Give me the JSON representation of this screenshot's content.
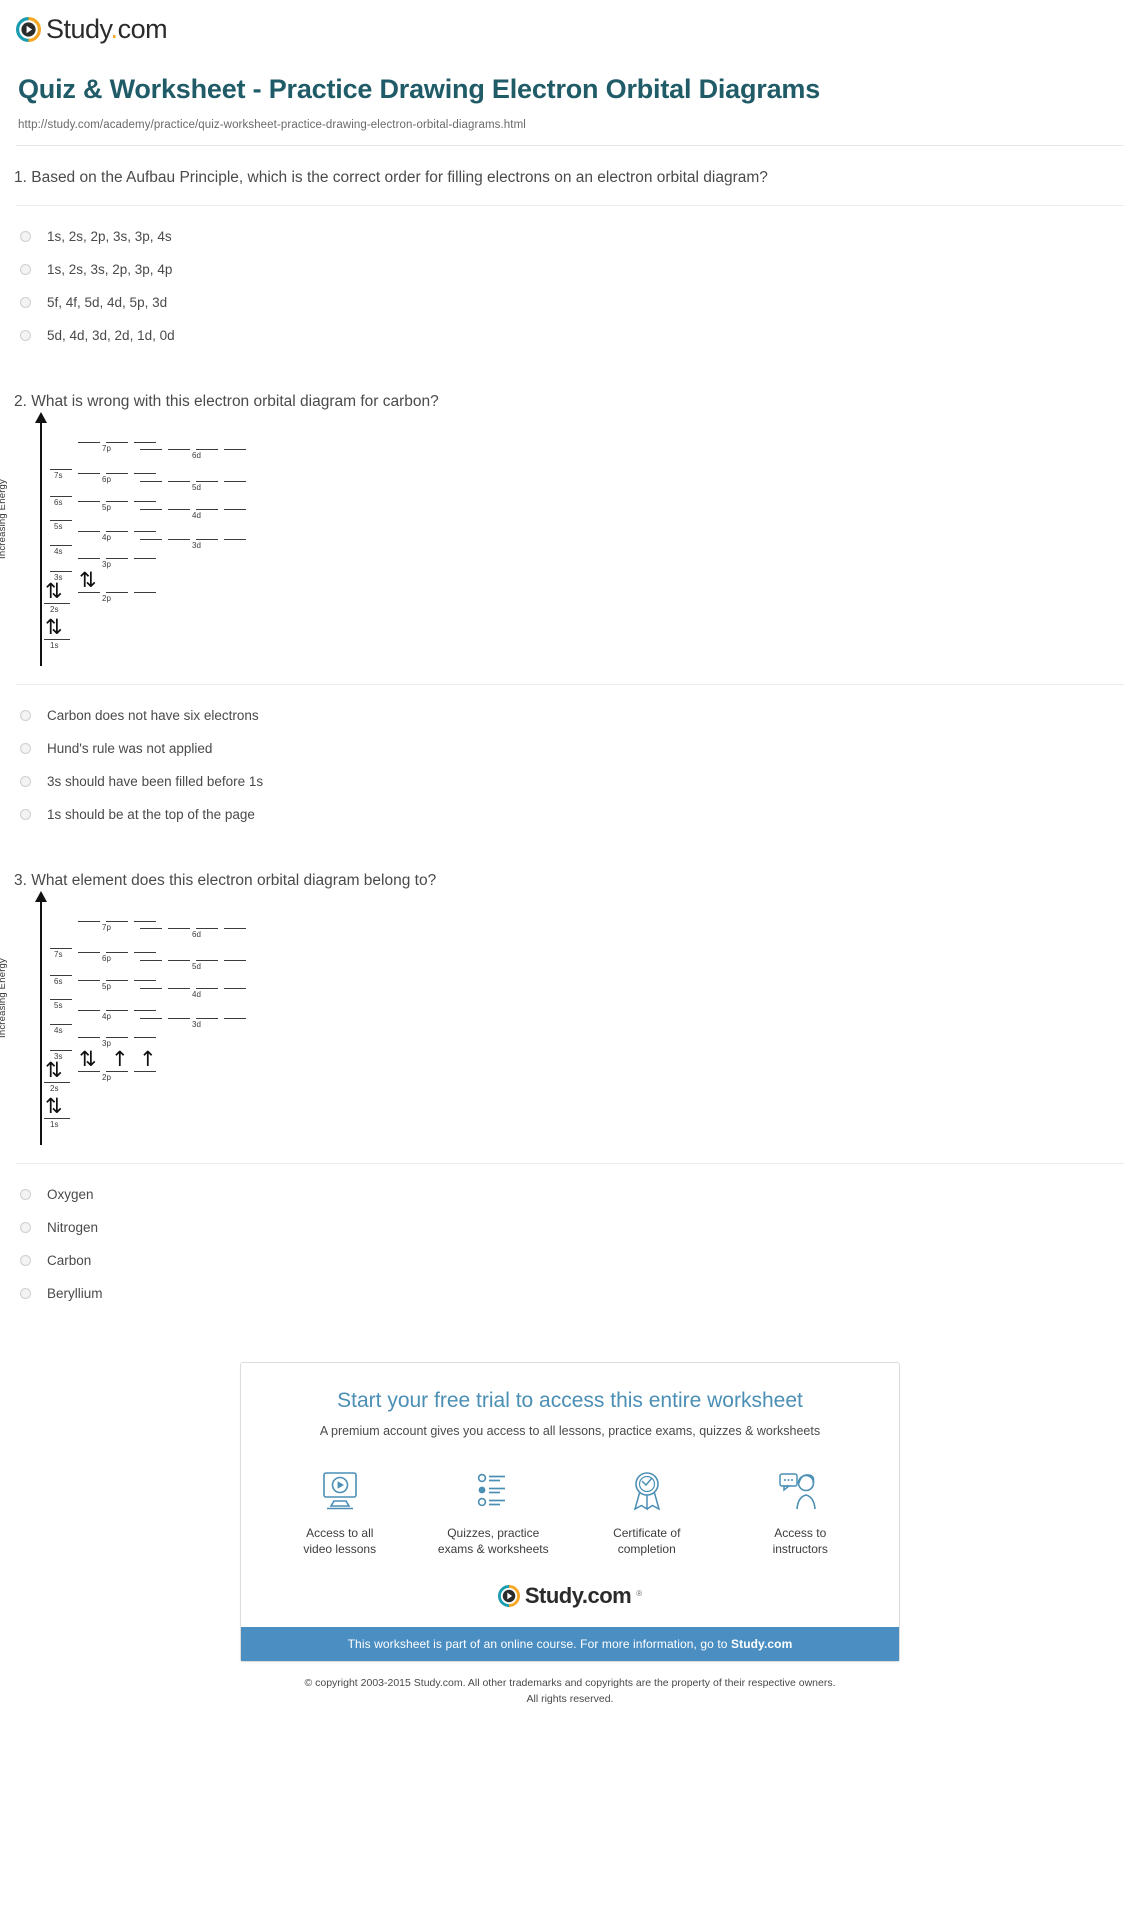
{
  "brand": {
    "logo_text": "Study",
    "logo_dot": ".",
    "logo_suffix": "com",
    "logo_icon": "play-circle-icon",
    "accent_teal": "#1a9cb0",
    "accent_orange": "#f5a623",
    "title_color": "#205b68",
    "banner_color": "#4a8ec2"
  },
  "header": {
    "title": "Quiz & Worksheet - Practice Drawing Electron Orbital Diagrams",
    "url": "http://study.com/academy/practice/quiz-worksheet-practice-drawing-electron-orbital-diagrams.html"
  },
  "questions": [
    {
      "number": "1.",
      "text": "1. Based on the Aufbau Principle, which is the correct order for filling electrons on an electron orbital diagram?",
      "has_diagram": false,
      "answers": [
        "1s, 2s, 2p, 3s, 3p, 4s",
        "1s, 2s, 3s, 2p, 3p, 4p",
        "5f, 4f, 5d, 4d, 5p, 3d",
        "5d, 4d, 3d, 2d, 1d, 0d"
      ]
    },
    {
      "number": "2.",
      "text": "2. What is wrong with this electron orbital diagram for carbon?",
      "has_diagram": true,
      "diagram_id": "carbon-orbital-diagram",
      "answers": [
        "Carbon does not have six electrons",
        "Hund's rule was not applied",
        "3s should have been filled before 1s",
        "1s should be at the top of the page"
      ]
    },
    {
      "number": "3.",
      "text": "3. What element does this electron orbital diagram belong to?",
      "has_diagram": true,
      "diagram_id": "unknown-element-orbital-diagram",
      "answers": [
        "Oxygen",
        "Nitrogen",
        "Carbon",
        "Beryllium"
      ]
    }
  ],
  "diagram": {
    "axis_label": "Increasing Energy",
    "orbital_labels": [
      "7p",
      "6d",
      "7s",
      "6p",
      "5d",
      "6s",
      "5p",
      "4d",
      "5s",
      "4p",
      "3d",
      "4s",
      "3p",
      "3s",
      "2s",
      "2p",
      "1s"
    ]
  },
  "diagram_q2": {
    "filled": {
      "1s": [
        "updown"
      ],
      "2s": [
        "updown"
      ],
      "2p": [
        "updown",
        "empty",
        "empty"
      ]
    }
  },
  "diagram_q3": {
    "filled": {
      "1s": [
        "updown"
      ],
      "2s": [
        "updown"
      ],
      "2p": [
        "updown",
        "up",
        "up"
      ]
    }
  },
  "promo": {
    "title": "Start your free trial to access this entire worksheet",
    "subtitle": "A premium account gives you access to all lessons, practice exams, quizzes & worksheets",
    "features": [
      {
        "icon": "video-monitor-icon",
        "line1": "Access to all",
        "line2": "video lessons"
      },
      {
        "icon": "checklist-icon",
        "line1": "Quizzes, practice",
        "line2": "exams & worksheets"
      },
      {
        "icon": "award-ribbon-icon",
        "line1": "Certificate of",
        "line2": "completion"
      },
      {
        "icon": "instructor-chat-icon",
        "line1": "Access to",
        "line2": "instructors"
      }
    ],
    "logo_text": "Study",
    "logo_dot": ".",
    "logo_suffix": "com",
    "trademark": "®",
    "banner_prefix": "This worksheet is part of an online course. For more information, go to ",
    "banner_link": "Study.com"
  },
  "footer": {
    "copyright_line1": "© copyright 2003-2015 Study.com. All other trademarks and copyrights are the property of their respective owners.",
    "copyright_line2": "All rights reserved."
  }
}
